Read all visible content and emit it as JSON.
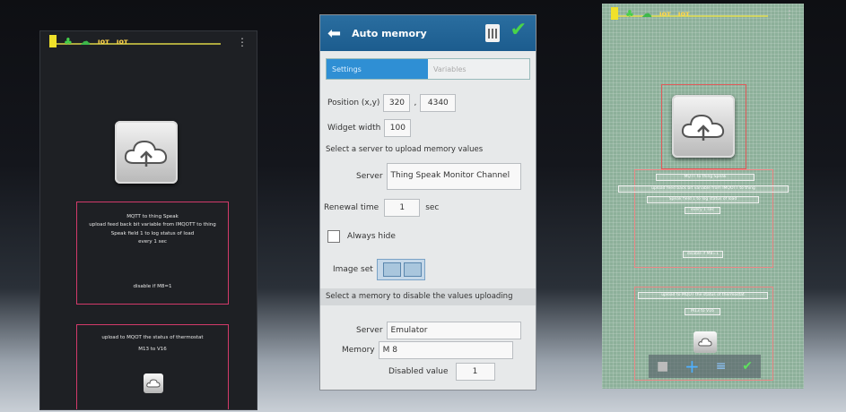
{
  "left_panel": {
    "box1": {
      "lines": [
        "MQTT to thing Speak",
        "upload feed back bit variable from IMQOTT to thing",
        "Speak field 1 to log status of load",
        "every 1 sec"
      ],
      "footer": "disable if M8=1"
    },
    "box2": {
      "lines": [
        "upload to MQOT the status of thermostat",
        "M13 to V16"
      ]
    }
  },
  "center_panel": {
    "title": "Auto memory",
    "tabs": [
      "Settings",
      "Variables"
    ],
    "position_label": "Position (x,y)",
    "position_x": "320",
    "position_sep": ",",
    "position_y": "4340",
    "widget_width_label": "Widget width",
    "widget_width": "100",
    "server_section_title": "Select a server to upload memory values",
    "server_label": "Server",
    "server_value": "Thing Speak Monitor Channel",
    "renewal_label": "Renewal time",
    "renewal_value": "1",
    "renewal_unit": "sec",
    "always_hide_label": "Always hide",
    "image_set_label": "Image set",
    "disable_section_title": "Select a memory to disable the values uploading",
    "server2_label": "Server",
    "server2_value": "Emulator",
    "memory_label": "Memory",
    "memory_value": "M 8",
    "disabled_value_label": "Disabled value",
    "disabled_value": "1"
  },
  "right_panel": {
    "box1_lines": [
      "MQTT to thing Speak",
      "upload feed back bit variable from IMQOTT to thing",
      "Speak field 1 to log status of load",
      "every 1 sec"
    ],
    "box1_footer": "disable if M8=1",
    "box2_lines": [
      "upload to MQOT the status of thermostat",
      "M13 to V16"
    ]
  }
}
